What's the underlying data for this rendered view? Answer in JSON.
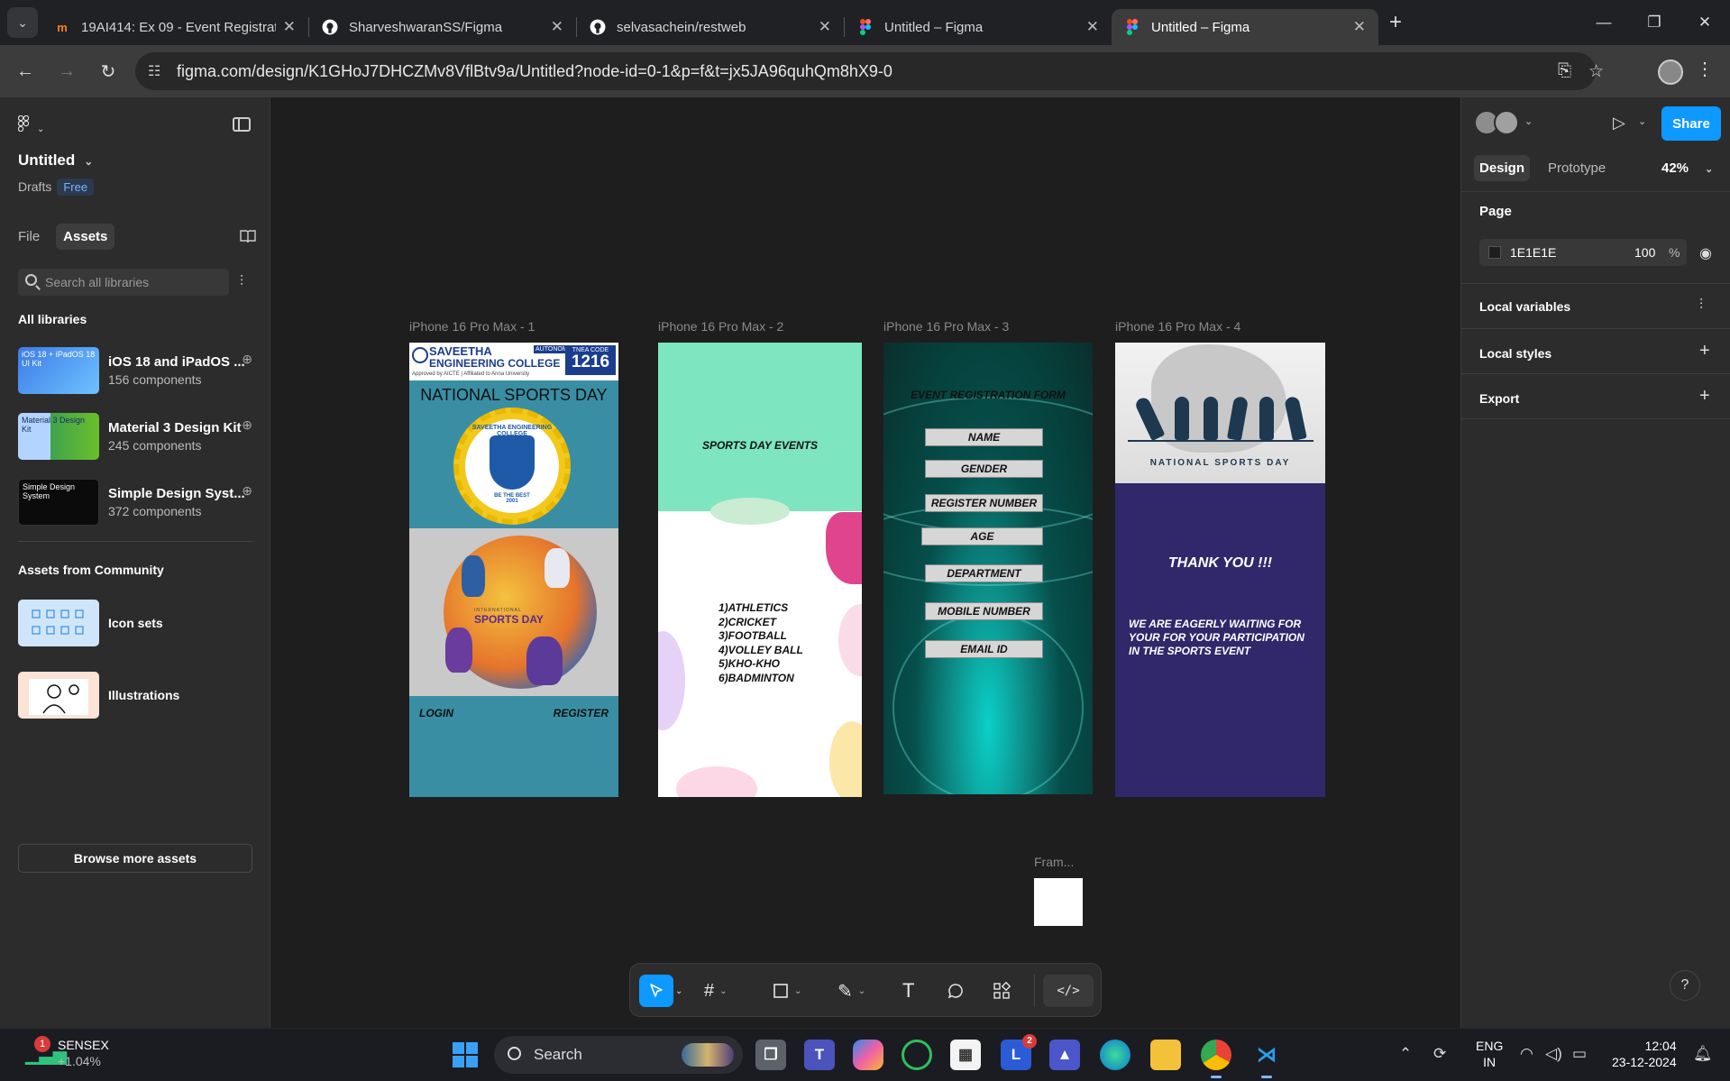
{
  "browser": {
    "tabs": [
      {
        "title": "19AI414: Ex 09 - Event Registrat",
        "icon": "moodle-icon"
      },
      {
        "title": "SharveshwaranSS/Figma",
        "icon": "github-icon"
      },
      {
        "title": "selvasachein/restweb",
        "icon": "github-icon"
      },
      {
        "title": "Untitled – Figma",
        "icon": "figma-icon"
      },
      {
        "title": "Untitled – Figma",
        "icon": "figma-icon"
      }
    ],
    "url": "figma.com/design/K1GHoJ7DHCZMv8VflBtv9a/Untitled?node-id=0-1&p=f&t=jx5JA96quhQm8hX9-0"
  },
  "left_panel": {
    "file_title": "Untitled",
    "drafts": "Drafts",
    "plan_badge": "Free",
    "tabs": [
      "File",
      "Assets"
    ],
    "search_placeholder": "Search all libraries",
    "all_libraries_heading": "All libraries",
    "libraries": [
      {
        "name": "iOS 18 and iPadOS ...",
        "count": "156 components",
        "thumb_text": "iOS 18 + iPadOS 18 UI Kit"
      },
      {
        "name": "Material 3 Design Kit",
        "count": "245 components",
        "thumb_text": "Material 3 Design Kit"
      },
      {
        "name": "Simple Design Syst...",
        "count": "372 components",
        "thumb_text": "Simple Design System"
      }
    ],
    "community_heading": "Assets from Community",
    "community": [
      {
        "name": "Icon sets"
      },
      {
        "name": "Illustrations"
      }
    ],
    "browse_button": "Browse more assets"
  },
  "canvas": {
    "frames": [
      {
        "label": "iPhone 16 Pro Max - 1"
      },
      {
        "label": "iPhone 16 Pro Max - 2"
      },
      {
        "label": "iPhone 16 Pro Max - 3"
      },
      {
        "label": "iPhone 16 Pro Max - 4"
      }
    ],
    "small_frame_label": "Fram...",
    "frame1": {
      "college_name_1": "SAVEETHA",
      "college_name_2": "ENGINEERING COLLEGE",
      "autonomous": "AUTONOMOUS",
      "tnea_label": "TNEA CODE",
      "tnea_code": "1216",
      "approval": "Approved by AICTE | Affiliated to Anna University",
      "title": "NATIONAL SPORTS DAY",
      "logo_top": "SAVEETHA ENGINEERING COLLEGE",
      "logo_motto": "BE THE BEST",
      "logo_year": "2001",
      "art_small": "INTERNATIONAL",
      "art_title": "SPORTS DAY",
      "login": "LOGIN",
      "register": "REGISTER"
    },
    "frame2": {
      "title": "SPORTS DAY EVENTS",
      "events": [
        "1)ATHLETICS",
        "2)CRICKET",
        "3)FOOTBALL",
        "4)VOLLEY BALL",
        "5)KHO-KHO",
        "6)BADMINTON"
      ]
    },
    "frame3": {
      "title": "EVENT REGISTRATION FORM",
      "fields": [
        "NAME",
        "GENDER",
        "REGISTER NUMBER",
        "AGE",
        "DEPARTMENT",
        "MOBILE NUMBER",
        "EMAIL ID"
      ]
    },
    "frame4": {
      "banner_text": "NATIONAL SPORTS DAY",
      "thank_you": "THANK YOU !!!",
      "message": "WE ARE EAGERLY WAITING FOR YOUR FOR YOUR PARTICIPATION IN THE SPORTS EVENT"
    }
  },
  "toolbar": {
    "tools": [
      "move-tool",
      "frame-tool",
      "shape-tool",
      "pen-tool",
      "text-tool",
      "comment-tool",
      "actions-tool",
      "dev-mode-toggle"
    ]
  },
  "right_panel": {
    "share_button": "Share",
    "tabs": [
      "Design",
      "Prototype"
    ],
    "zoom": "42%",
    "page_heading": "Page",
    "page_color": "1E1E1E",
    "page_opacity": "100",
    "percent": "%",
    "local_variables": "Local variables",
    "local_styles": "Local styles",
    "export": "Export"
  },
  "taskbar": {
    "stock_name": "SENSEX",
    "stock_change": "+1.04%",
    "stock_notifications": "1",
    "search_label": "Search",
    "launcher_badge": "2",
    "lang_1": "ENG",
    "lang_2": "IN",
    "time": "12:04",
    "date": "23-12-2024"
  },
  "colors": {
    "accent": "#0d99ff",
    "canvas_bg": "#1E1E1E"
  }
}
